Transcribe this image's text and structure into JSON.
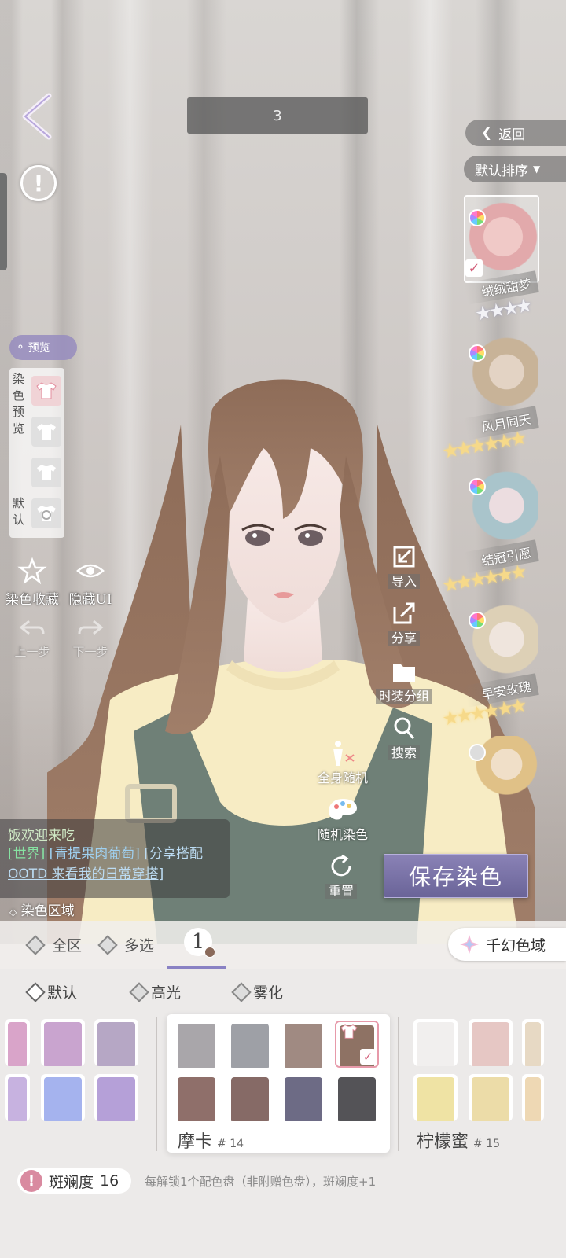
{
  "top": {
    "counter": "3",
    "return_label": "返回",
    "sort_label": "默认排序"
  },
  "hairstyles": [
    {
      "name": "绒绒甜梦",
      "stars": "★★★★",
      "star_color": "silver",
      "selected": true,
      "tint": "#e8b7b7"
    },
    {
      "name": "风月同天",
      "stars": "★★★★★★",
      "star_color": "gold",
      "selected": false,
      "tint": "#cdbaa0"
    },
    {
      "name": "结冠引愿",
      "stars": "★★★★★★",
      "star_color": "gold",
      "selected": false,
      "tint": "#b9cfd6"
    },
    {
      "name": "早安玫瑰",
      "stars": "★★★★★★",
      "star_color": "gold",
      "selected": false,
      "tint": "#e2d8c0"
    }
  ],
  "left_panel": {
    "preview_toggle": "预览",
    "dye_preview_label": [
      "染",
      "色",
      "预",
      "览"
    ],
    "default_label": [
      "默",
      "认"
    ],
    "dye_favorite": "染色收藏",
    "hide_ui": "隐藏UI",
    "undo": "上一步",
    "redo": "下一步"
  },
  "actions": {
    "import": "导入",
    "share": "分享",
    "outfit_group": "时装分组",
    "search": "搜索",
    "full_random": "全身随机",
    "random_dye": "随机染色",
    "reset": "重置",
    "save_dye": "保存染色"
  },
  "chat": {
    "line1": "饭欢迎来吃",
    "channel": "[世界]",
    "user": "[青提果肉葡萄]",
    "message": "[分享搭配OOTD 来看我的日常穿搭]"
  },
  "dye_region_label": "染色区域",
  "tabs": {
    "all": "全区",
    "multi": "多选",
    "region_number": "1",
    "qianhuan": "千幻色域"
  },
  "sub_tabs": {
    "default": "默认",
    "highlight": "高光",
    "mist": "雾化"
  },
  "palettes": {
    "left_colors": [
      "#d9a4c9",
      "#c9a4cf",
      "#b6a7c5",
      "#c7b2e0",
      "#a5b3ee",
      "#b5a0d8"
    ],
    "mocha": {
      "name": "摩卡",
      "number": "# 14",
      "colors": [
        "#a9a6aa",
        "#9ea0a6",
        "#a08a82",
        "#8e7264",
        "#8f6f6a",
        "#866a66",
        "#6d6b85",
        "#545357"
      ]
    },
    "lemon_honey": {
      "name": "柠檬蜜",
      "number": "# 15",
      "colors": [
        "#f1efee",
        "#e6c7c4",
        "#e7d9c4",
        "#efe3a4",
        "#ecdca8",
        "#eed8b4"
      ]
    }
  },
  "beauty": {
    "label": "斑斓度",
    "value": "16",
    "note": "每解锁1个配色盘（非附赠色盘），斑斓度+1"
  }
}
